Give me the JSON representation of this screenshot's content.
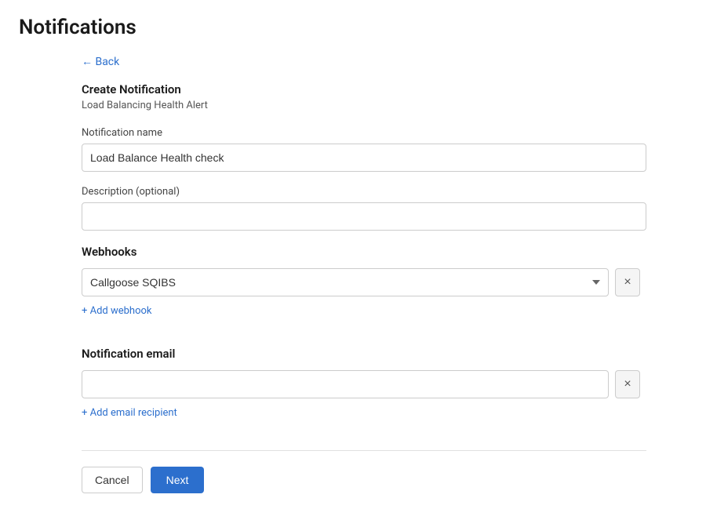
{
  "page": {
    "title": "Notifications"
  },
  "back_link": {
    "label": "← Back"
  },
  "form": {
    "header_title": "Create Notification",
    "header_subtitle": "Load Balancing Health Alert",
    "notification_name_label": "Notification name",
    "notification_name_value": "Load Balance Health check",
    "description_label": "Description (optional)",
    "description_value": "",
    "description_placeholder": "",
    "webhooks_section_title": "Webhooks",
    "webhook_selected": "Callgoose SQIBS",
    "webhook_options": [
      "Callgoose SQIBS"
    ],
    "add_webhook_label": "+ Add webhook",
    "email_section_title": "Notification email",
    "email_value": "",
    "email_placeholder": "",
    "add_email_label": "+ Add email recipient",
    "cancel_label": "Cancel",
    "next_label": "Next"
  },
  "icons": {
    "clear_x": "×"
  }
}
